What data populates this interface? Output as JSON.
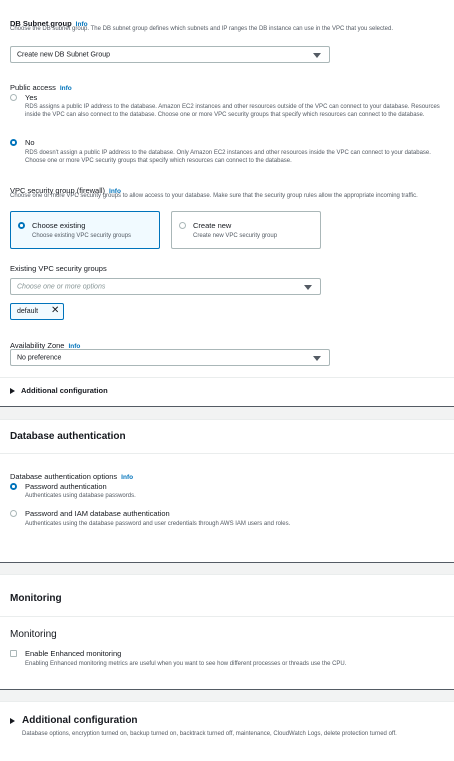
{
  "subnet": {
    "label": "DB Subnet group",
    "info": "Info",
    "desc": "Choose the DB subnet group. The DB subnet group defines which subnets and IP ranges the DB instance can use in the VPC that you selected.",
    "value": "Create new DB Subnet Group"
  },
  "public_access": {
    "label": "Public access",
    "info": "Info",
    "yes_title": "Yes",
    "yes_desc": "RDS assigns a public IP address to the database. Amazon EC2 instances and other resources outside of the VPC can connect to your database. Resources inside the VPC can also connect to the database. Choose one or more VPC security groups that specify which resources can connect to the database.",
    "no_title": "No",
    "no_desc": "RDS doesn't assign a public IP address to the database. Only Amazon EC2 instances and other resources inside the VPC can connect to your database. Choose one or more VPC security groups that specify which resources can connect to the database.",
    "selected": "No"
  },
  "vpc_sg": {
    "label": "VPC security group (firewall)",
    "info": "Info",
    "desc": "Choose one or more VPC security groups to allow access to your database. Make sure that the security group rules allow the appropriate incoming traffic.",
    "choose_existing_title": "Choose existing",
    "choose_existing_desc": "Choose existing VPC security groups",
    "create_new_title": "Create new",
    "create_new_desc": "Create new VPC security group"
  },
  "existing_sg": {
    "label": "Existing VPC security groups",
    "placeholder": "Choose one or more options",
    "token": "default"
  },
  "az": {
    "label": "Availability Zone",
    "info": "Info",
    "value": "No preference"
  },
  "additional_config_small": "Additional configuration",
  "db_auth": {
    "title": "Database authentication",
    "options_label": "Database authentication options",
    "info": "Info",
    "password_title": "Password authentication",
    "password_desc": "Authenticates using database passwords.",
    "iam_title": "Password and IAM database authentication",
    "iam_desc": "Authenticates using the database password and user credentials through AWS IAM users and roles."
  },
  "monitoring": {
    "title": "Monitoring",
    "subtitle": "Monitoring",
    "enhanced_title": "Enable Enhanced monitoring",
    "enhanced_desc": "Enabling Enhanced monitoring metrics are useful when you want to see how different processes or threads use the CPU."
  },
  "additional_config": {
    "title": "Additional configuration",
    "desc": "Database options, encryption turned on, backup turned on, backtrack turned off, maintenance, CloudWatch Logs, delete protection turned off."
  },
  "colors": {
    "accent": "#0073bb",
    "text": "#16191f",
    "muted": "#545b64",
    "border": "#aab7b8"
  }
}
